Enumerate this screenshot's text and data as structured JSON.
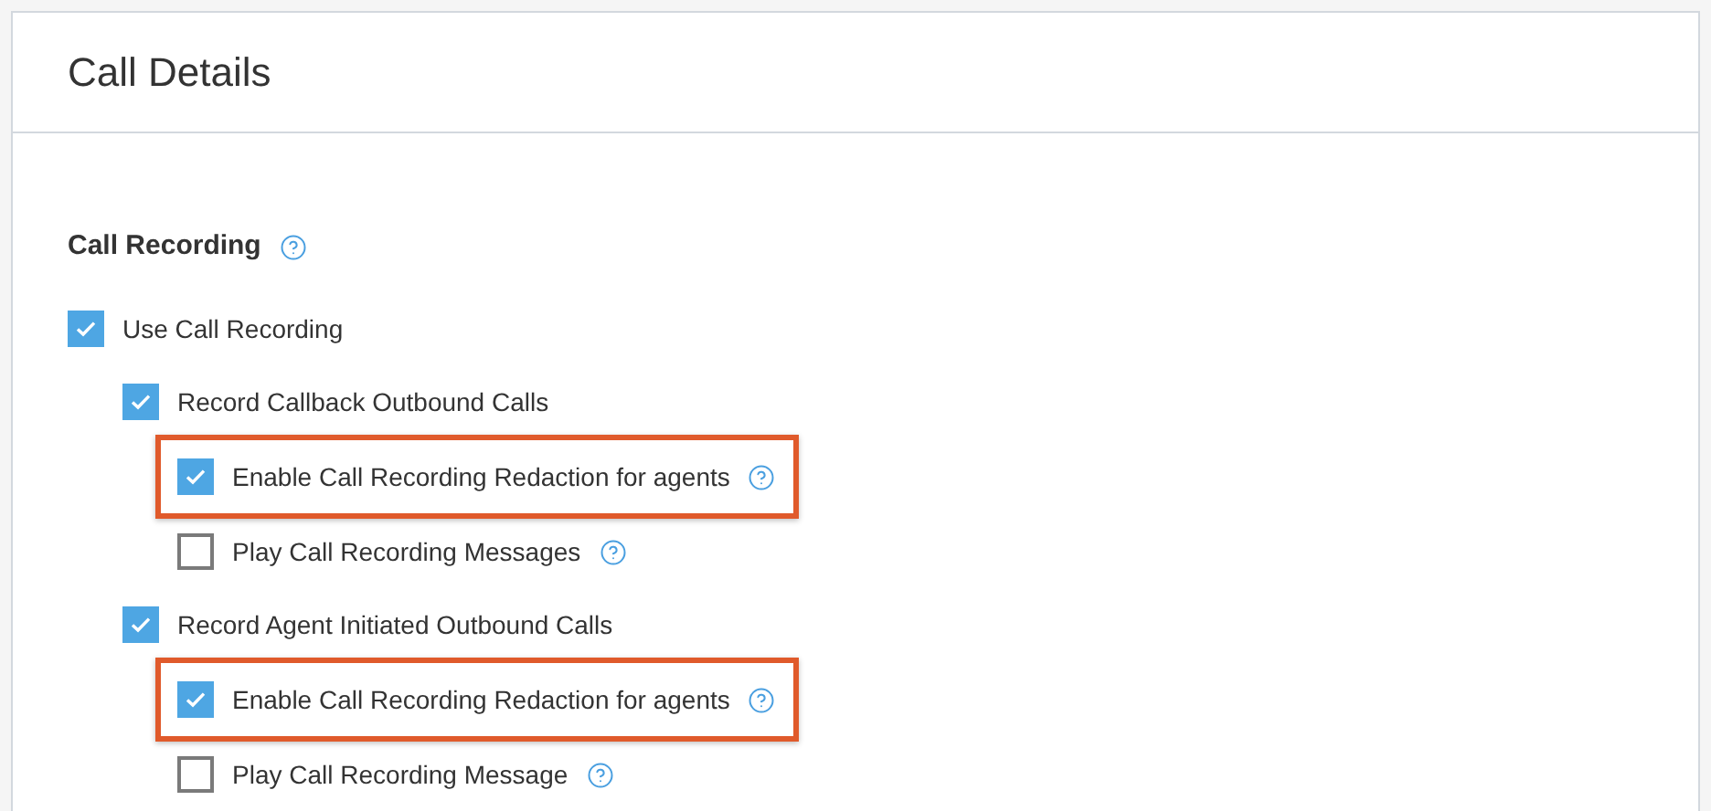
{
  "card": {
    "title": "Call Details"
  },
  "section": {
    "title": "Call Recording",
    "help": true
  },
  "options": [
    {
      "label": "Use Call Recording",
      "checked": true,
      "help": false,
      "highlighted": false,
      "children": [
        {
          "label": "Record Callback Outbound Calls",
          "checked": true,
          "help": false,
          "highlighted": false,
          "children": [
            {
              "label": "Enable Call Recording Redaction for agents",
              "checked": true,
              "help": true,
              "highlighted": true
            },
            {
              "label": "Play Call Recording Messages",
              "checked": false,
              "help": true,
              "highlighted": false
            }
          ]
        },
        {
          "label": "Record Agent Initiated Outbound Calls",
          "checked": true,
          "help": false,
          "highlighted": false,
          "children": [
            {
              "label": "Enable Call Recording Redaction for agents",
              "checked": true,
              "help": true,
              "highlighted": true
            },
            {
              "label": "Play Call Recording Message",
              "checked": false,
              "help": true,
              "highlighted": false
            }
          ]
        }
      ]
    }
  ]
}
